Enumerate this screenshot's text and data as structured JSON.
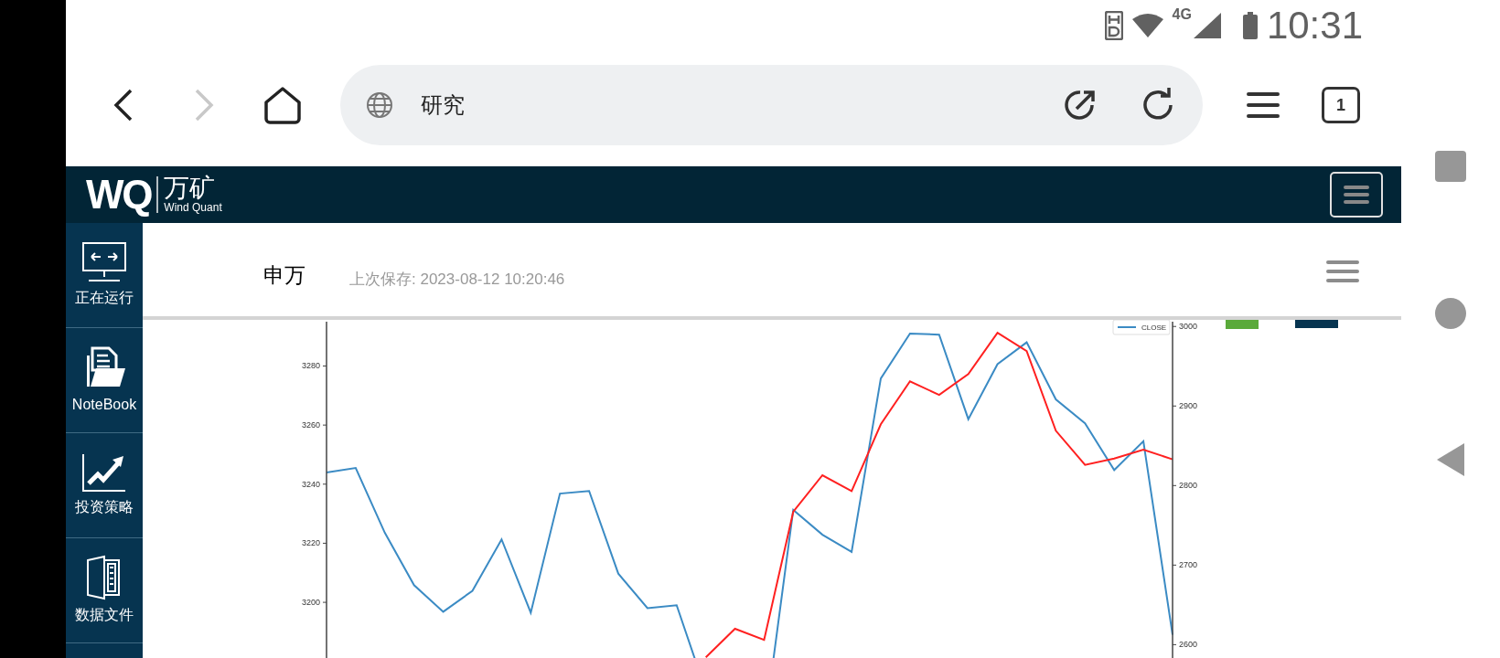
{
  "status_bar": {
    "network": "4G",
    "time": "10:31"
  },
  "browser": {
    "address": "研究",
    "tab_count": "1"
  },
  "app_header": {
    "logo_mark": "WQ",
    "logo_text": "万矿",
    "logo_subtitle": "Wind Quant"
  },
  "sidebar": {
    "items": [
      {
        "kind": "running",
        "label": "正在运行"
      },
      {
        "kind": "notebook",
        "label": "NoteBook"
      },
      {
        "kind": "strategy",
        "label": "投资策略"
      },
      {
        "kind": "data",
        "label": "数据文件"
      }
    ]
  },
  "page": {
    "title": "申万",
    "saved": "上次保存: 2023-08-12 10:20:46"
  },
  "chart": {
    "left_axis": {
      "chart_data": {
        "type": "line",
        "categories": [
          null,
          null,
          null,
          null,
          null,
          null,
          null,
          null,
          null,
          null,
          null,
          null,
          null,
          null,
          null,
          null,
          null,
          null,
          null,
          null,
          null,
          null,
          null,
          null,
          null,
          null,
          null,
          null,
          null,
          null
        ],
        "ylim": [
          3110,
          3295
        ],
        "yticks": [
          3200,
          3220,
          3240,
          3260,
          3280
        ],
        "series": [
          {
            "name": "CLOSE",
            "color": "#3b8bc4",
            "values": [
              3244,
              3245.5,
              3223.5,
              3205.8,
              3196.8,
              3203.9,
              3221.3,
              3196.5,
              3236.8,
              3237.7,
              3209.7,
              3198,
              3199,
              3170,
              null,
              3157,
              3231.3,
              3222.9,
              3217.1,
              3275.8,
              3291,
              3290.6,
              3262,
              3280.6,
              3288,
              3268.7,
              3260.6,
              3244.8,
              3254.5,
              3189
            ]
          }
        ]
      }
    },
    "right_axis": {
      "chart_data": {
        "type": "line",
        "categories": [
          null,
          null,
          null,
          null,
          null,
          null,
          null,
          null,
          null,
          null,
          null,
          null,
          null,
          null,
          null,
          null,
          null,
          null,
          null,
          null,
          null,
          null,
          null,
          null,
          null,
          null,
          null,
          null,
          null,
          null
        ],
        "ylim": [
          2319,
          3006
        ],
        "yticks": [
          2600,
          2700,
          2800,
          2900,
          3000
        ],
        "series": [
          {
            "color": "#ff2020",
            "values": [
              null,
              null,
              null,
              null,
              null,
              null,
              null,
              null,
              null,
              null,
              null,
              null,
              null,
              2584,
              2620,
              2606,
              2767,
              2813,
              2793,
              2877,
              2931,
              2914,
              2940,
              2992,
              2969,
              2869,
              2826,
              2834,
              2845,
              2833
            ]
          }
        ]
      }
    }
  }
}
